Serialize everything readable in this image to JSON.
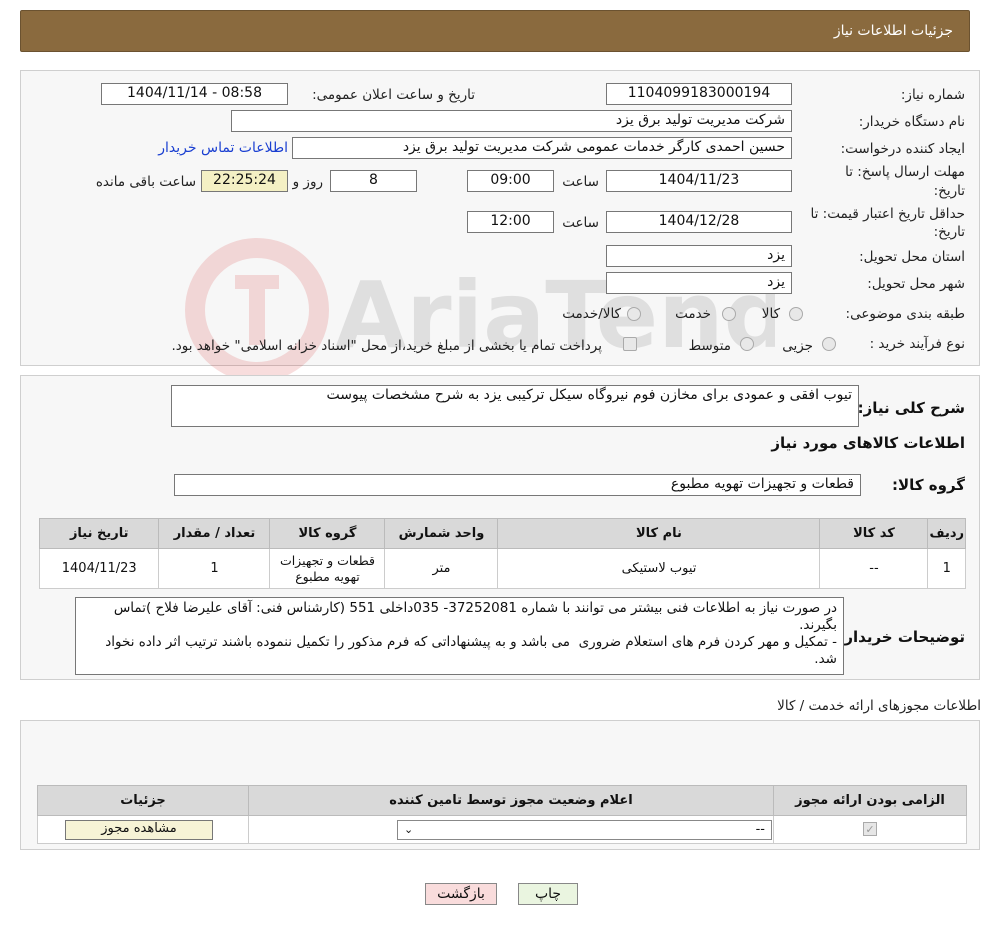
{
  "header": {
    "title": "جزئیات اطلاعات نیاز"
  },
  "form": {
    "need_number_label": "شماره نیاز:",
    "need_number": "1104099183000194",
    "announce_label": "تاریخ و ساعت اعلان عمومی:",
    "announce_value": "1404/11/14 - 08:58",
    "buyer_org_label": "نام دستگاه خریدار:",
    "buyer_org": "شرکت مدیریت تولید برق یزد",
    "creator_label": "ایجاد کننده درخواست:",
    "creator": "حسین احمدی کارگر خدمات عمومی شرکت مدیریت تولید برق یزد",
    "contact_link": "اطلاعات تماس خریدار",
    "deadline_label_1": "مهلت ارسال پاسخ: تا",
    "deadline_label_2": "تاریخ:",
    "deadline_date": "1404/11/23",
    "time_label": "ساعت",
    "deadline_time": "09:00",
    "days_value": "8",
    "days_label": "روز و",
    "remaining_time": "22:25:24",
    "remaining_label": "ساعت باقی مانده",
    "validity_label_1": "حداقل تاریخ اعتبار قیمت: تا",
    "validity_label_2": "تاریخ:",
    "validity_date": "1404/12/28",
    "validity_time_label": "ساعت",
    "validity_time": "12:00",
    "province_label": "استان محل تحویل:",
    "province": "یزد",
    "city_label": "شهر محل تحویل:",
    "city": "یزد",
    "category_label": "طبقه بندی موضوعی:",
    "category_options": [
      "کالا",
      "خدمت",
      "کالا/خدمت"
    ],
    "process_label": "نوع فرآیند خرید :",
    "process_options": [
      "جزیی",
      "متوسط"
    ],
    "process_note": "پرداخت تمام یا بخشی از مبلغ خرید،از محل \"اسناد خزانه اسلامی\" خواهد بود."
  },
  "details": {
    "summary_label": "شرح کلی نیاز:",
    "summary": "تیوب افقی و عمودی برای مخازن فوم نیروگاه سیکل ترکیبی یزد به شرح مشخصات پیوست",
    "goods_info_title": "اطلاعات کالاهای مورد نیاز",
    "goods_group_label": "گروه کالا:",
    "goods_group": "قطعات و تجهیزات تهویه مطبوع",
    "table_headers": [
      "ردیف",
      "کد کالا",
      "نام کالا",
      "واحد شمارش",
      "گروه کالا",
      "تعداد / مقدار",
      "تاریخ نیاز"
    ],
    "table_rows": [
      [
        "1",
        "--",
        "تیوب لاستیکی",
        "متر",
        "قطعات و تجهیزات تهویه مطبوع",
        "1",
        "1404/11/23"
      ]
    ],
    "buyer_notes_label": "توضیحات خریدار:",
    "buyer_notes": "در صورت نیاز به اطلاعات فنی بیشتر می توانند با شماره 37252081- 035داخلی 551 (کارشناس فنی: آقای علیرضا فلاح )تماس بگیرند.\n- تمکیل و مهر کردن فرم های استعلام ضروری  می باشد و به پیشنهاداتی که فرم مذکور را تکمیل ننموده باشند ترتیب اثر داده نخواد شد."
  },
  "permits": {
    "title": "اطلاعات مجوزهای ارائه خدمت / کالا",
    "table_headers": [
      "الزامی بودن ارائه مجوز",
      "اعلام وضعیت مجوز توسط تامین کننده",
      "جزئیات"
    ],
    "select_value": "--",
    "view_button": "مشاهده مجوز"
  },
  "buttons": {
    "print": "چاپ",
    "back": "بازگشت"
  },
  "watermark_text": "AriaTender.neT",
  "colors": {
    "header_bg": "#8a6a3e",
    "link": "#1a3fd1",
    "yellow_box": "#f4f0c4",
    "back_button": "#f9dcdc",
    "print_button": "#eaf5e0"
  }
}
